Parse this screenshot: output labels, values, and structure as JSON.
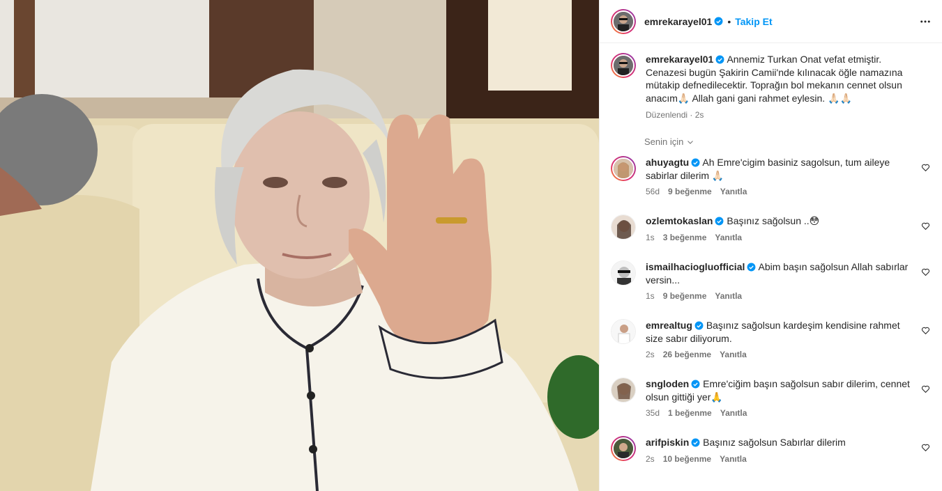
{
  "post": {
    "username": "emrekarayel01",
    "follow_label": "Takip Et",
    "separator": "•",
    "caption": "Annemiz Turkan Onat vefat etmiştir. Cenazesi bugün Şakirin Camii'nde kılınacak öğle namazına mütakip defnedilecektir. Toprağın bol mekanın cennet olsun anacım🙏🏻 Allah gani gani rahmet eylesin. 🙏🏻🙏🏻",
    "edited": "Düzenlendi · 2s",
    "sort_label": "Senin için"
  },
  "comments": [
    {
      "user": "ahuyagtu",
      "text": "Ah Emre'cigim basiniz sagolsun, tum aileye sabirlar dilerim 🙏🏻",
      "age": "56d",
      "likes": "9 beğenme",
      "reply": "Yanıtla",
      "ring": true
    },
    {
      "user": "ozlemtokaslan",
      "text": "Başınız sağolsun ..😳",
      "age": "1s",
      "likes": "3 beğenme",
      "reply": "Yanıtla",
      "ring": false
    },
    {
      "user": "ismailhaciogluofficial",
      "text": "Abim başın sağolsun Allah sabırlar versin...",
      "age": "1s",
      "likes": "9 beğenme",
      "reply": "Yanıtla",
      "ring": false
    },
    {
      "user": "emrealtug",
      "text": "Başınız sağolsun kardeşim kendisine rahmet size sabır diliyorum.",
      "age": "2s",
      "likes": "26 beğenme",
      "reply": "Yanıtla",
      "ring": false
    },
    {
      "user": "sngloden",
      "text": "Emre'ciğim başın sağolsun sabır dilerim, cennet olsun gittiği yer🙏",
      "age": "35d",
      "likes": "1 beğenme",
      "reply": "Yanıtla",
      "ring": false
    },
    {
      "user": "arifpiskin",
      "text": "Başınız sağolsun Sabırlar dilerim",
      "age": "2s",
      "likes": "10 beğenme",
      "reply": "Yanıtla",
      "ring": true
    }
  ],
  "colors": {
    "accent": "#0095f6",
    "verified": "#0095f6",
    "muted": "#737373"
  },
  "icons": {
    "more": "more-horizontal-icon",
    "verified": "verified-badge-icon",
    "heart": "heart-outline-icon",
    "chevron": "chevron-down-icon"
  }
}
